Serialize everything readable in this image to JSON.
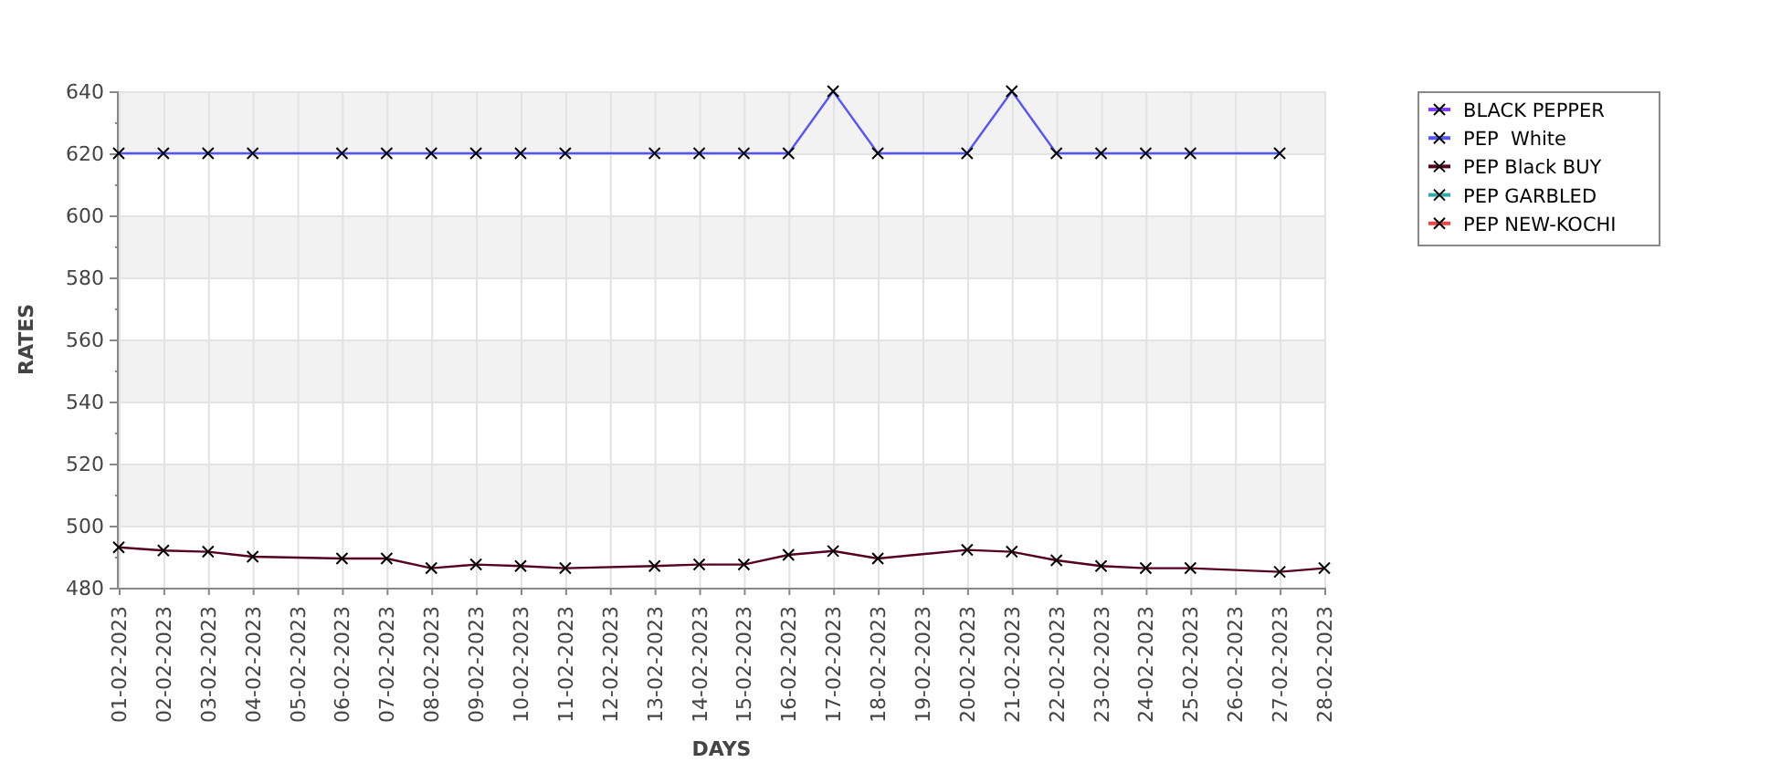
{
  "chart_data": {
    "type": "line",
    "xlabel": "DAYS",
    "ylabel": "RATES",
    "grid": true,
    "legend": true,
    "categories": [
      "01-02-2023",
      "02-02-2023",
      "03-02-2023",
      "04-02-2023",
      "05-02-2023",
      "06-02-2023",
      "07-02-2023",
      "08-02-2023",
      "09-02-2023",
      "10-02-2023",
      "11-02-2023",
      "12-02-2023",
      "13-02-2023",
      "14-02-2023",
      "15-02-2023",
      "16-02-2023",
      "17-02-2023",
      "18-02-2023",
      "19-02-2023",
      "20-02-2023",
      "21-02-2023",
      "22-02-2023",
      "23-02-2023",
      "24-02-2023",
      "25-02-2023",
      "26-02-2023",
      "27-02-2023",
      "28-02-2023"
    ],
    "ylim": [
      480,
      640
    ],
    "yticks": [
      480,
      500,
      520,
      540,
      560,
      580,
      600,
      620,
      640
    ],
    "series": [
      {
        "name": "BLACK PEPPER",
        "color": "#7f3fff",
        "marker": "x",
        "values": [
          null,
          null,
          null,
          null,
          null,
          null,
          null,
          null,
          null,
          null,
          null,
          null,
          null,
          null,
          null,
          null,
          null,
          null,
          null,
          null,
          null,
          null,
          null,
          null,
          null,
          null,
          null,
          null
        ]
      },
      {
        "name": "PEP  White",
        "color": "#5555ff",
        "marker": "x",
        "values": [
          620,
          620,
          620,
          620,
          null,
          620,
          620,
          620,
          620,
          620,
          620,
          null,
          620,
          620,
          620,
          620,
          640,
          620,
          null,
          620,
          640,
          620,
          620,
          620,
          620,
          null,
          620,
          null
        ]
      },
      {
        "name": "PEP Black BUY",
        "color": "#550022",
        "marker": "x",
        "values": [
          493,
          492,
          491.6,
          490,
          null,
          489.4,
          489.4,
          486.3,
          487.5,
          487,
          486.3,
          null,
          487,
          487.5,
          487.5,
          490.6,
          491.8,
          489.4,
          null,
          492.2,
          491.6,
          488.8,
          487,
          486.3,
          486.3,
          null,
          485.1,
          486.3
        ]
      },
      {
        "name": "PEP GARBLED",
        "color": "#33aaaa",
        "marker": "x",
        "values": [
          null,
          null,
          null,
          null,
          null,
          null,
          null,
          null,
          null,
          null,
          null,
          null,
          null,
          null,
          null,
          null,
          null,
          null,
          null,
          null,
          null,
          null,
          null,
          null,
          null,
          null,
          null,
          null
        ]
      },
      {
        "name": "PEP NEW-KOCHI",
        "color": "#ee4444",
        "marker": "x",
        "values": [
          null,
          null,
          null,
          null,
          null,
          null,
          null,
          null,
          null,
          null,
          null,
          null,
          null,
          null,
          null,
          null,
          null,
          null,
          null,
          null,
          null,
          null,
          null,
          null,
          null,
          null,
          null,
          null
        ]
      }
    ]
  }
}
